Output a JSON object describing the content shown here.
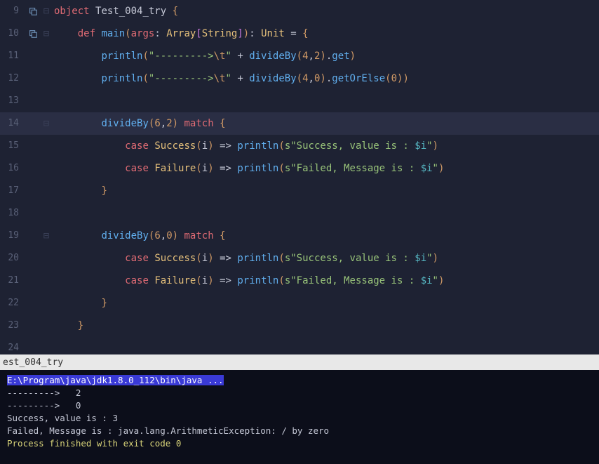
{
  "editor": {
    "lines": [
      {
        "num": "9",
        "hasIcon": true
      },
      {
        "num": "10",
        "hasIcon": true
      },
      {
        "num": "11"
      },
      {
        "num": "12"
      },
      {
        "num": "13"
      },
      {
        "num": "14",
        "highlighted": true
      },
      {
        "num": "15"
      },
      {
        "num": "16"
      },
      {
        "num": "17"
      },
      {
        "num": "18"
      },
      {
        "num": "19"
      },
      {
        "num": "20"
      },
      {
        "num": "21"
      },
      {
        "num": "22"
      },
      {
        "num": "23"
      },
      {
        "num": "24"
      }
    ],
    "tokens": {
      "l9_object": "object",
      "l9_name": "Test_004_try",
      "l9_brace": "{",
      "l10_def": "def",
      "l10_main": "main",
      "l10_lp": "(",
      "l10_args": "args",
      "l10_colon": ": ",
      "l10_array": "Array",
      "l10_lb": "[",
      "l10_string": "String",
      "l10_rb": "]",
      "l10_rp": ")",
      "l10_colon2": ": ",
      "l10_unit": "Unit",
      "l10_eq": " = ",
      "l10_brace": "{",
      "l11_println": "println",
      "l11_lp": "(",
      "l11_str1": "\"--------->",
      "l11_esc": "\\t",
      "l11_str2": "\"",
      "l11_plus": " + ",
      "l11_divideBy": "divideBy",
      "l11_lp2": "(",
      "l11_n1": "4",
      "l11_comma": ",",
      "l11_n2": "2",
      "l11_rp2": ")",
      "l11_dot": ".",
      "l11_get": "get",
      "l11_rp": ")",
      "l12_println": "println",
      "l12_lp": "(",
      "l12_str1": "\"--------->",
      "l12_esc": "\\t",
      "l12_str2": "\"",
      "l12_plus": " + ",
      "l12_divideBy": "divideBy",
      "l12_lp2": "(",
      "l12_n1": "4",
      "l12_comma": ",",
      "l12_n2": "0",
      "l12_rp2": ")",
      "l12_dot": ".",
      "l12_getOrElse": "getOrElse",
      "l12_lp3": "(",
      "l12_n3": "0",
      "l12_rp3": ")",
      "l12_rp": ")",
      "l14_divideBy": "divideBy",
      "l14_lp": "(",
      "l14_n1": "6",
      "l14_comma": ",",
      "l14_n2": "2",
      "l14_rp": ")",
      "l14_match": "match",
      "l14_brace": "{",
      "l15_case": "case",
      "l15_success": "Success",
      "l15_lp": "(",
      "l15_i": "i",
      "l15_rp": ")",
      "l15_arrow": " => ",
      "l15_println": "println",
      "l15_lp2": "(",
      "l15_s": "s",
      "l15_str": "\"Success, value is : ",
      "l15_interp": "$i",
      "l15_strend": "\"",
      "l15_rp2": ")",
      "l16_case": "case",
      "l16_failure": "Failure",
      "l16_lp": "(",
      "l16_i": "i",
      "l16_rp": ")",
      "l16_arrow": " => ",
      "l16_println": "println",
      "l16_lp2": "(",
      "l16_s": "s",
      "l16_str": "\"Failed, Message is : ",
      "l16_interp": "$i",
      "l16_strend": "\"",
      "l16_rp2": ")",
      "l17_brace": "}",
      "l19_divideBy": "divideBy",
      "l19_lp": "(",
      "l19_n1": "6",
      "l19_comma": ",",
      "l19_n2": "0",
      "l19_rp": ")",
      "l19_match": "match",
      "l19_brace": "{",
      "l20_case": "case",
      "l20_success": "Success",
      "l20_lp": "(",
      "l20_i": "i",
      "l20_rp": ")",
      "l20_arrow": " => ",
      "l20_println": "println",
      "l20_lp2": "(",
      "l20_s": "s",
      "l20_str": "\"Success, value is : ",
      "l20_interp": "$i",
      "l20_strend": "\"",
      "l20_rp2": ")",
      "l21_case": "case",
      "l21_failure": "Failure",
      "l21_lp": "(",
      "l21_i": "i",
      "l21_rp": ")",
      "l21_arrow": " => ",
      "l21_println": "println",
      "l21_lp2": "(",
      "l21_s": "s",
      "l21_str": "\"Failed, Message is : ",
      "l21_interp": "$i",
      "l21_strend": "\"",
      "l21_rp2": ")",
      "l22_brace": "}",
      "l23_brace": "}"
    }
  },
  "tab": {
    "label": "est_004_try"
  },
  "console": {
    "cmd": "E:\\Program\\java\\jdk1.8.0_112\\bin\\java ...",
    "out1": "--------->   2",
    "out2": "--------->   0",
    "out3": "Success, value is : 3",
    "out4": "Failed, Message is : java.lang.ArithmeticException: / by zero",
    "blank": "",
    "exit": "Process finished with exit code 0"
  }
}
